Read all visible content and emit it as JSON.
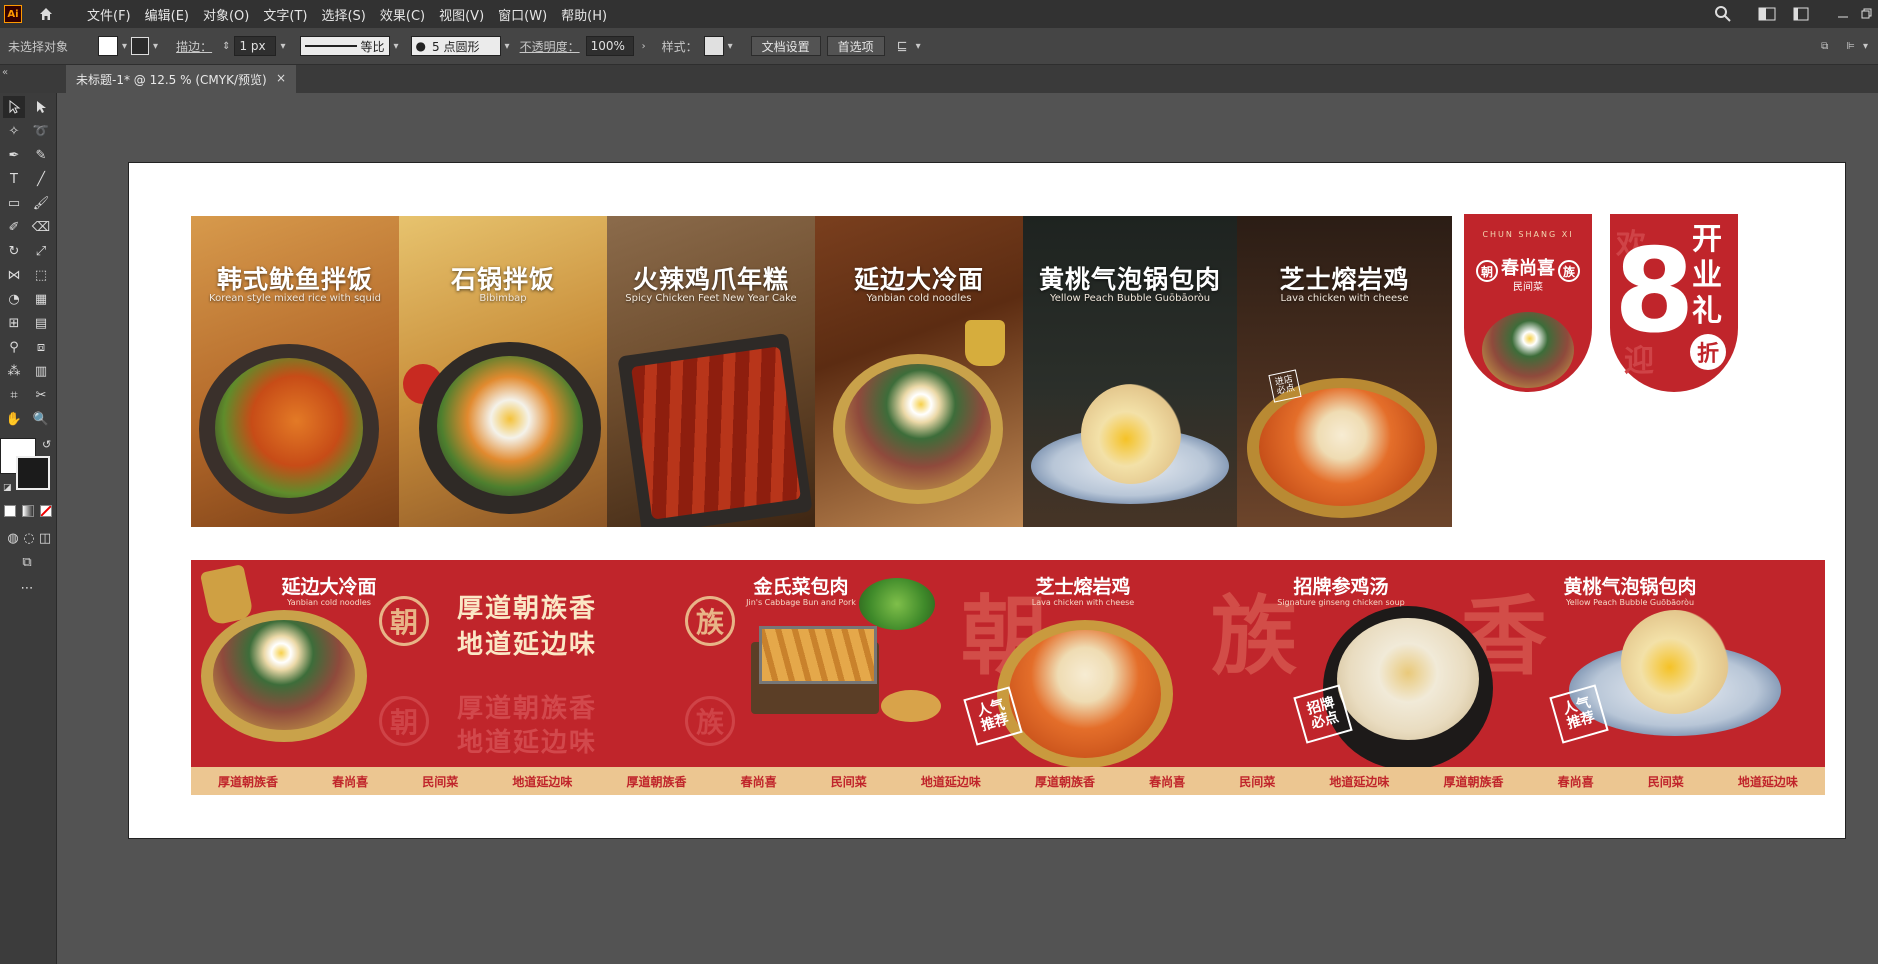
{
  "app": {
    "logo": "Ai"
  },
  "menu": [
    "文件(F)",
    "编辑(E)",
    "对象(O)",
    "文字(T)",
    "选择(S)",
    "效果(C)",
    "视图(V)",
    "窗口(W)",
    "帮助(H)"
  ],
  "control": {
    "no_selection": "未选择对象",
    "stroke_label": "描边：",
    "stroke_value": "1 px",
    "stroke_profile": "等比",
    "brush": "5 点圆形",
    "opacity_label": "不透明度：",
    "opacity_value": "100%",
    "style_label": "样式：",
    "doc_setup": "文档设置",
    "preferences": "首选项"
  },
  "tab": {
    "title": "未标题-1* @ 12.5 % (CMYK/预览)",
    "close": "×"
  },
  "poster": {
    "dishes": [
      {
        "name": "韩式鱿鱼拌饭",
        "en": "Korean style mixed rice with squid"
      },
      {
        "name": "石锅拌饭",
        "en": "Bibimbap"
      },
      {
        "name": "火辣鸡爪年糕",
        "en": "Spicy Chicken Feet New Year Cake"
      },
      {
        "name": "延边大冷面",
        "en": "Yanbian cold noodles"
      },
      {
        "name": "黄桃气泡锅包肉",
        "en": "Yellow Peach Bubble Guōbāoròu"
      },
      {
        "name": "芝士熔岩鸡",
        "en": "Lava chicken with cheese"
      }
    ],
    "brand": {
      "pinyin": "CHUN SHANG XI",
      "name": "春尚喜",
      "sub": "民间菜",
      "left_mark": "朝",
      "right_mark": "族"
    },
    "opening": {
      "number": "8",
      "line1": "开",
      "line2": "业",
      "line3": "礼",
      "discount": "折",
      "bg1": "欢",
      "bg2": "迎"
    },
    "shop_badge": "进店必点"
  },
  "banner": {
    "slogan1": "厚道朝族香",
    "slogan2": "地道延边味",
    "mark_left": "朝",
    "mark_right": "族",
    "bg_chars": [
      "朝",
      "族",
      "香"
    ],
    "items": [
      {
        "name": "延边大冷面",
        "en": "Yanbian cold noodles"
      },
      {
        "name": "金氏菜包肉",
        "en": "Jin's Cabbage Bun and Pork"
      },
      {
        "name": "芝士熔岩鸡",
        "en": "Lava chicken with cheese"
      },
      {
        "name": "招牌参鸡汤",
        "en": "Signature ginseng chicken soup"
      },
      {
        "name": "黄桃气泡锅包肉",
        "en": "Yellow Peach Bubble Guōbāoròu"
      }
    ],
    "stamps": [
      {
        "l1": "人气",
        "l2": "推荐"
      },
      {
        "l1": "招牌",
        "l2": "必点"
      },
      {
        "l1": "人气",
        "l2": "推荐"
      }
    ],
    "strip_items": [
      "厚道朝族香",
      "春尚喜",
      "民间菜",
      "地道延边味"
    ]
  }
}
